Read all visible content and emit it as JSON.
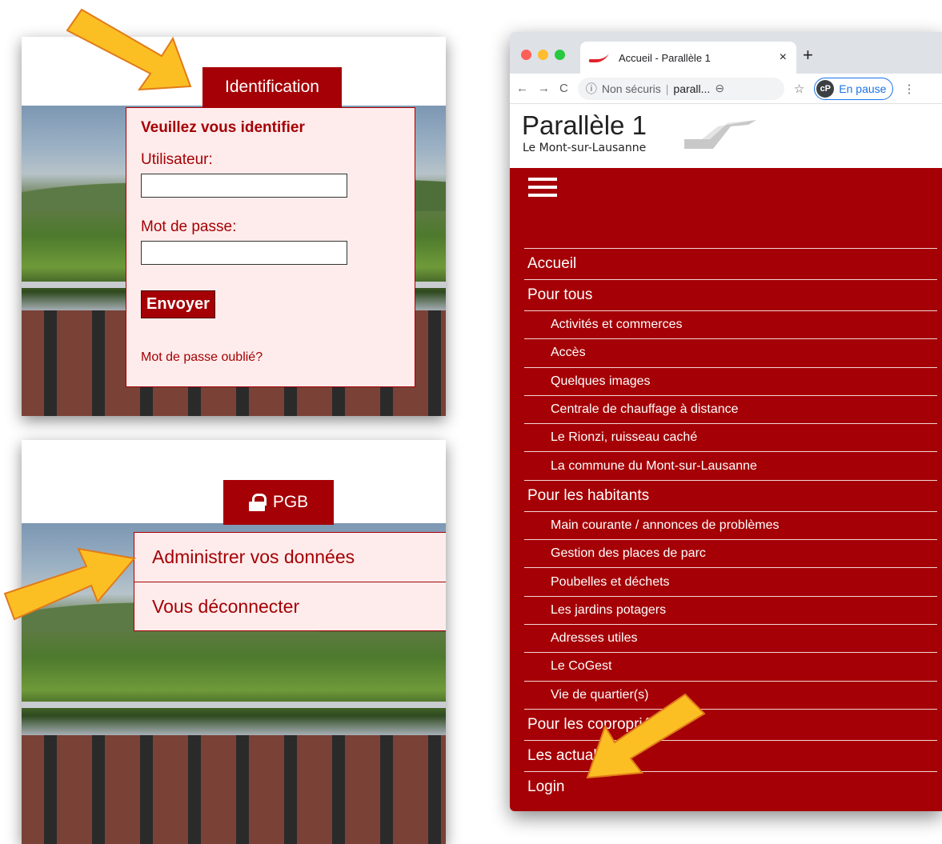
{
  "login_panel": {
    "tab_label": "Identification",
    "heading": "Veuillez vous identifier",
    "user_label": "Utilisateur:",
    "user_value": "",
    "password_label": "Mot de passe:",
    "password_value": "",
    "submit_label": "Envoyer",
    "forgot_label": "Mot de passe oublié?"
  },
  "account_panel": {
    "tab_label": "PGB",
    "menu": [
      "Administrer vos données",
      "Vous déconnecter"
    ]
  },
  "browser": {
    "tab_title": "Accueil - Parallèle 1",
    "tab_close": "×",
    "new_tab": "+",
    "nav": {
      "back": "←",
      "forward": "→",
      "reload": "C"
    },
    "address": {
      "security": "Non sécuris",
      "host": "parall..."
    },
    "icons": {
      "zoom": "⊖",
      "star": "☆",
      "more": "⋮"
    },
    "profile": {
      "initials": "cP",
      "label": "En pause"
    }
  },
  "site": {
    "title": "Parallèle 1",
    "subtitle": "Le Mont-sur-Lausanne",
    "menu": [
      {
        "label": "Accueil",
        "level": "top"
      },
      {
        "label": "Pour tous",
        "level": "top"
      },
      {
        "label": "Activités et commerces",
        "level": "sub"
      },
      {
        "label": "Accès",
        "level": "sub"
      },
      {
        "label": "Quelques images",
        "level": "sub"
      },
      {
        "label": "Centrale de chauffage à distance",
        "level": "sub"
      },
      {
        "label": "Le Rionzi, ruisseau caché",
        "level": "sub"
      },
      {
        "label": "La commune du Mont-sur-Lausanne",
        "level": "sub"
      },
      {
        "label": "Pour les habitants",
        "level": "top"
      },
      {
        "label": "Main courante / annonces de problèmes",
        "level": "sub"
      },
      {
        "label": "Gestion des places de parc",
        "level": "sub"
      },
      {
        "label": "Poubelles et déchets",
        "level": "sub"
      },
      {
        "label": "Les jardins potagers",
        "level": "sub"
      },
      {
        "label": "Adresses utiles",
        "level": "sub"
      },
      {
        "label": "Le CoGest",
        "level": "sub"
      },
      {
        "label": "Vie de quartier(s)",
        "level": "sub"
      },
      {
        "label": "Pour les coproprié",
        "level": "top"
      },
      {
        "label": "Les actuali",
        "level": "top"
      },
      {
        "label": "Login",
        "level": "top"
      }
    ]
  },
  "colors": {
    "brand_red": "#a50005",
    "panel_pink": "#fdeceb",
    "arrow": "#fbbf24"
  }
}
